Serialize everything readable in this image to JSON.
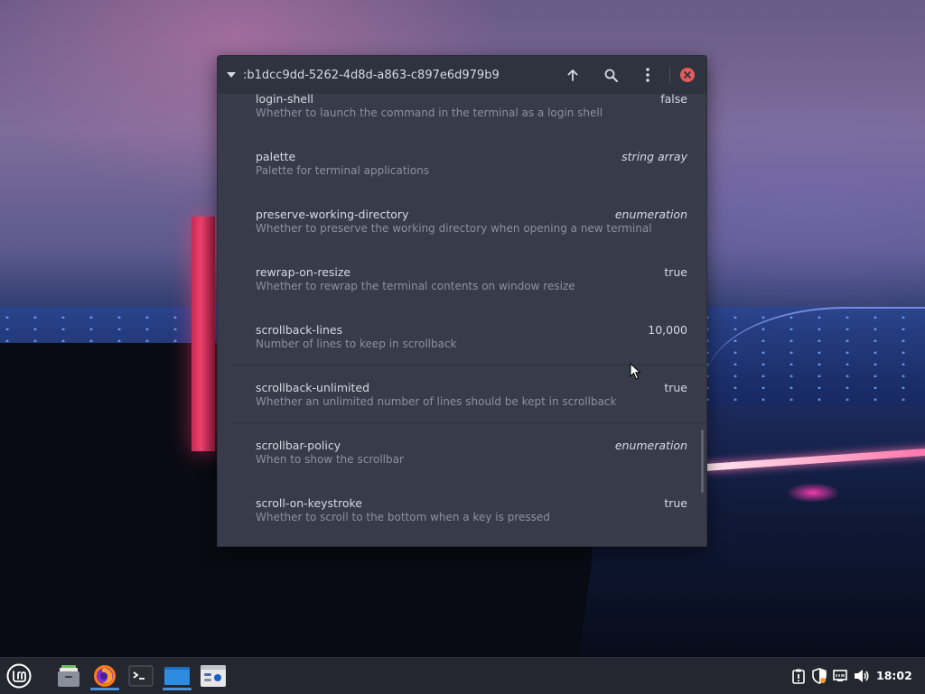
{
  "window": {
    "path": ":b1dcc9dd-5262-4d8d-a863-c897e6d979b9",
    "icons": [
      "chevron-down-icon",
      "arrow-up-icon",
      "search-icon",
      "kebab-menu-icon",
      "close-icon"
    ]
  },
  "settings": [
    {
      "key": "login-shell",
      "desc": "Whether to launch the command in the terminal as a login shell",
      "value": "false",
      "italic": false
    },
    {
      "key": "palette",
      "desc": "Palette for terminal applications",
      "value": "string array",
      "italic": true
    },
    {
      "key": "preserve-working-directory",
      "desc": "Whether to preserve the working directory when opening a new terminal",
      "value": "enumeration",
      "italic": true
    },
    {
      "key": "rewrap-on-resize",
      "desc": "Whether to rewrap the terminal contents on window resize",
      "value": "true",
      "italic": false
    },
    {
      "key": "scrollback-lines",
      "desc": "Number of lines to keep in scrollback",
      "value": "10,000",
      "italic": false
    },
    {
      "key": "scrollback-unlimited",
      "desc": "Whether an unlimited number of lines should be kept in scrollback",
      "value": "true",
      "italic": false
    },
    {
      "key": "scrollbar-policy",
      "desc": "When to show the scrollbar",
      "value": "enumeration",
      "italic": true
    },
    {
      "key": "scroll-on-keystroke",
      "desc": "Whether to scroll to the bottom when a key is pressed",
      "value": "true",
      "italic": false
    }
  ],
  "taskbar": {
    "apps": [
      "mint-menu-icon",
      "files-icon",
      "firefox-icon",
      "terminal-icon",
      "window-icon",
      "dconf-editor-icon"
    ],
    "tray": [
      "clipboard-icon",
      "shield-icon",
      "network-icon",
      "volume-icon"
    ],
    "clock": "18:02"
  },
  "colors": {
    "window_bg": "#383c4a",
    "titlebar_bg": "#2f333d",
    "close": "#e65b5b",
    "taskbar_bg": "#24272f",
    "accent": "#4a90d9"
  }
}
